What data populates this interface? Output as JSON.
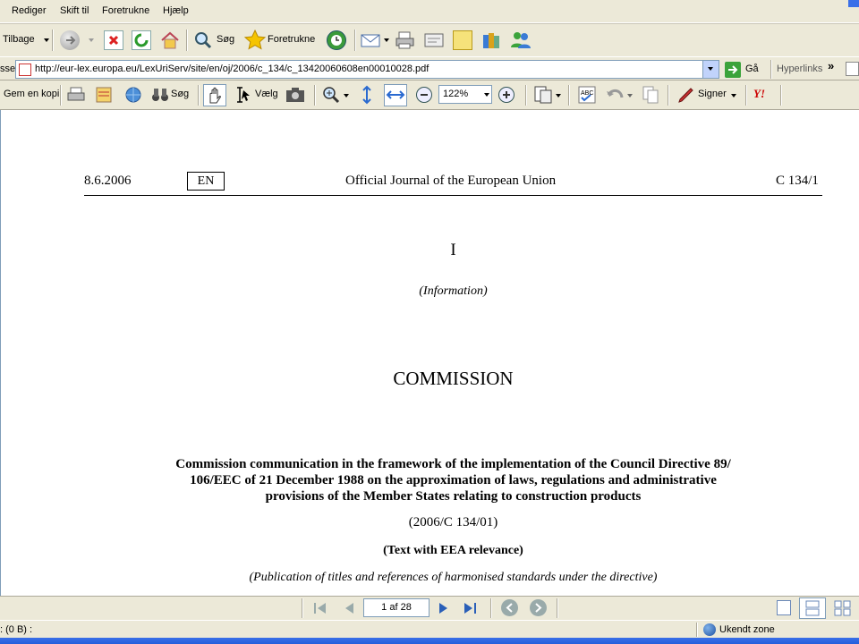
{
  "menu": {
    "items": [
      "Rediger",
      "Skift til",
      "Foretrukne",
      "Hjælp"
    ]
  },
  "standard_toolbar": {
    "back_label": "Tilbage",
    "search_label": "Søg",
    "favorites_label": "Foretrukne"
  },
  "address_bar": {
    "label_fragment": "sse",
    "url": "http://eur-lex.europa.eu/LexUriServ/site/en/oj/2006/c_134/c_13420060608en00010028.pdf",
    "go_label": "Gå",
    "links_label": "Hyperlinks"
  },
  "pdf_toolbar": {
    "save_copy_label": "Gem en kopi",
    "search_label": "Søg",
    "select_label": "Vælg",
    "zoom_value": "122%",
    "sign_label": "Signer"
  },
  "document": {
    "header": {
      "date": "8.6.2006",
      "language": "EN",
      "journal": "Official Journal of the European Union",
      "ref": "C 134/1"
    },
    "part_number": "I",
    "part_name": "(Information)",
    "institution": "COMMISSION",
    "title_lines": [
      "Commission communication in the framework of the implementation of the Council Directive 89/",
      "106/EEC of 21 December 1988 on the approximation of laws, regulations and administrative",
      "provisions of the Member States relating to construction products"
    ],
    "doc_number": "(2006/C 134/01)",
    "relevance": "(Text with EEA relevance)",
    "publication": "(Publication of titles and references of harmonised standards under the directive)"
  },
  "navigation": {
    "page_value": "1 af 28"
  },
  "status": {
    "left_text": ": (0 B) :",
    "zone_text": "Ukendt zone"
  }
}
